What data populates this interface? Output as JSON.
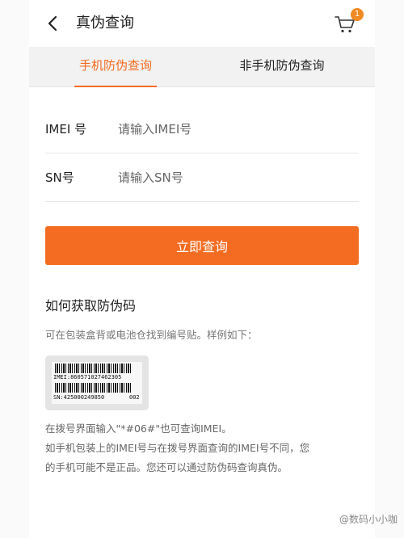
{
  "header": {
    "title": "真伪查询",
    "cart_badge": "1"
  },
  "tabs": [
    {
      "label": "手机防伪查询",
      "active": true
    },
    {
      "label": "非手机防伪查询",
      "active": false
    }
  ],
  "form": {
    "imei_label": "IMEI 号",
    "imei_placeholder": "请输入IMEI号",
    "sn_label": "SN号",
    "sn_placeholder": "请输入SN号",
    "submit_label": "立即查询"
  },
  "help": {
    "title": "如何获取防伪码",
    "description": "可在包装盒背或电池仓找到编号贴。样例如下：",
    "sample_label": {
      "imei_text": "IMEI:860571027462305",
      "sn_text": "SN:425000249850",
      "code_text": "002"
    },
    "notes": [
      "在拨号界面输入\"*#06#\"也可查询IMEI。",
      "如手机包装上的IMEI号与在拨号界面查询的IMEI号不同，您",
      "的手机可能不是正品。您还可以通过防伪码查询真伪。"
    ]
  },
  "watermark": "@数码小小咖",
  "colors": {
    "accent": "#f36c21",
    "badge": "#f08a24",
    "tab_bar_bg": "#f2f2f2"
  },
  "icons": {
    "back": "back-arrow-icon",
    "cart": "shopping-cart-icon"
  }
}
